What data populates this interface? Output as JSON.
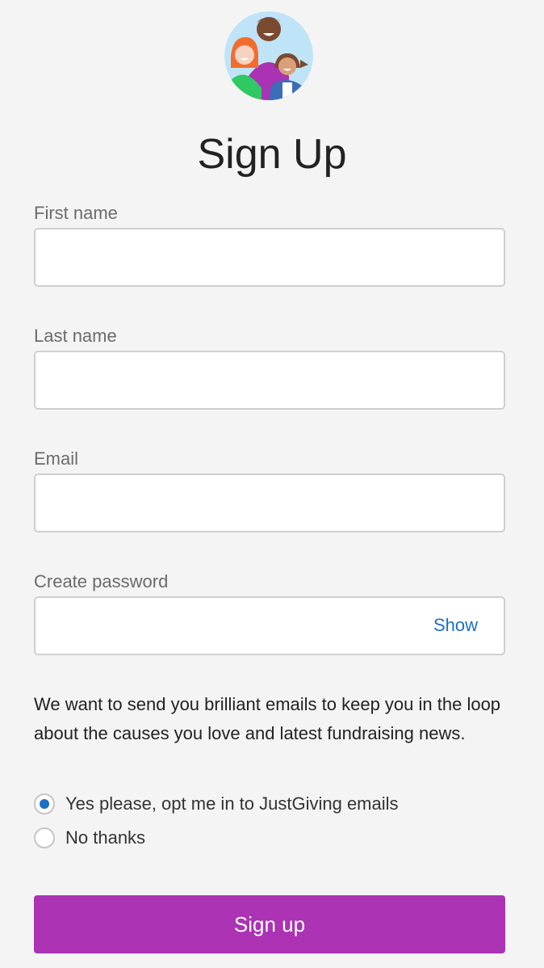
{
  "header": {
    "title": "Sign Up",
    "avatar_icon": "people-group-icon"
  },
  "form": {
    "first_name": {
      "label": "First name",
      "value": "",
      "placeholder": ""
    },
    "last_name": {
      "label": "Last name",
      "value": "",
      "placeholder": ""
    },
    "email": {
      "label": "Email",
      "value": "",
      "placeholder": ""
    },
    "password": {
      "label": "Create password",
      "value": "",
      "placeholder": "",
      "toggle_label": "Show"
    }
  },
  "marketing": {
    "intro": "We want to send you brilliant emails to keep you in the loop about the causes you love and latest fundraising news.",
    "options": [
      {
        "label": "Yes please, opt me in to JustGiving emails",
        "selected": true
      },
      {
        "label": "No thanks",
        "selected": false
      }
    ]
  },
  "actions": {
    "submit_label": "Sign up"
  },
  "colors": {
    "background": "#f4f4f4",
    "primary_button": "#ab33b4",
    "link": "#1e6fc6",
    "radio_selected": "#1e6fc6"
  }
}
